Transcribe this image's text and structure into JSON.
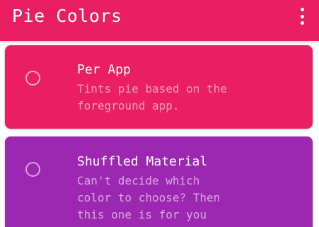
{
  "appbar": {
    "title": "Pie Colors",
    "background": "#e91e63",
    "overflow_icon": "more-vert-icon"
  },
  "options": [
    {
      "title": "Per App",
      "description": "Tints pie based on the\nforeground app.",
      "color": "#ea1f63",
      "selected": false
    },
    {
      "title": "Shuffled Material",
      "description": "Can't decide which\ncolor to choose? Then\nthis one is for you",
      "color": "#9c27b0",
      "selected": false
    }
  ]
}
